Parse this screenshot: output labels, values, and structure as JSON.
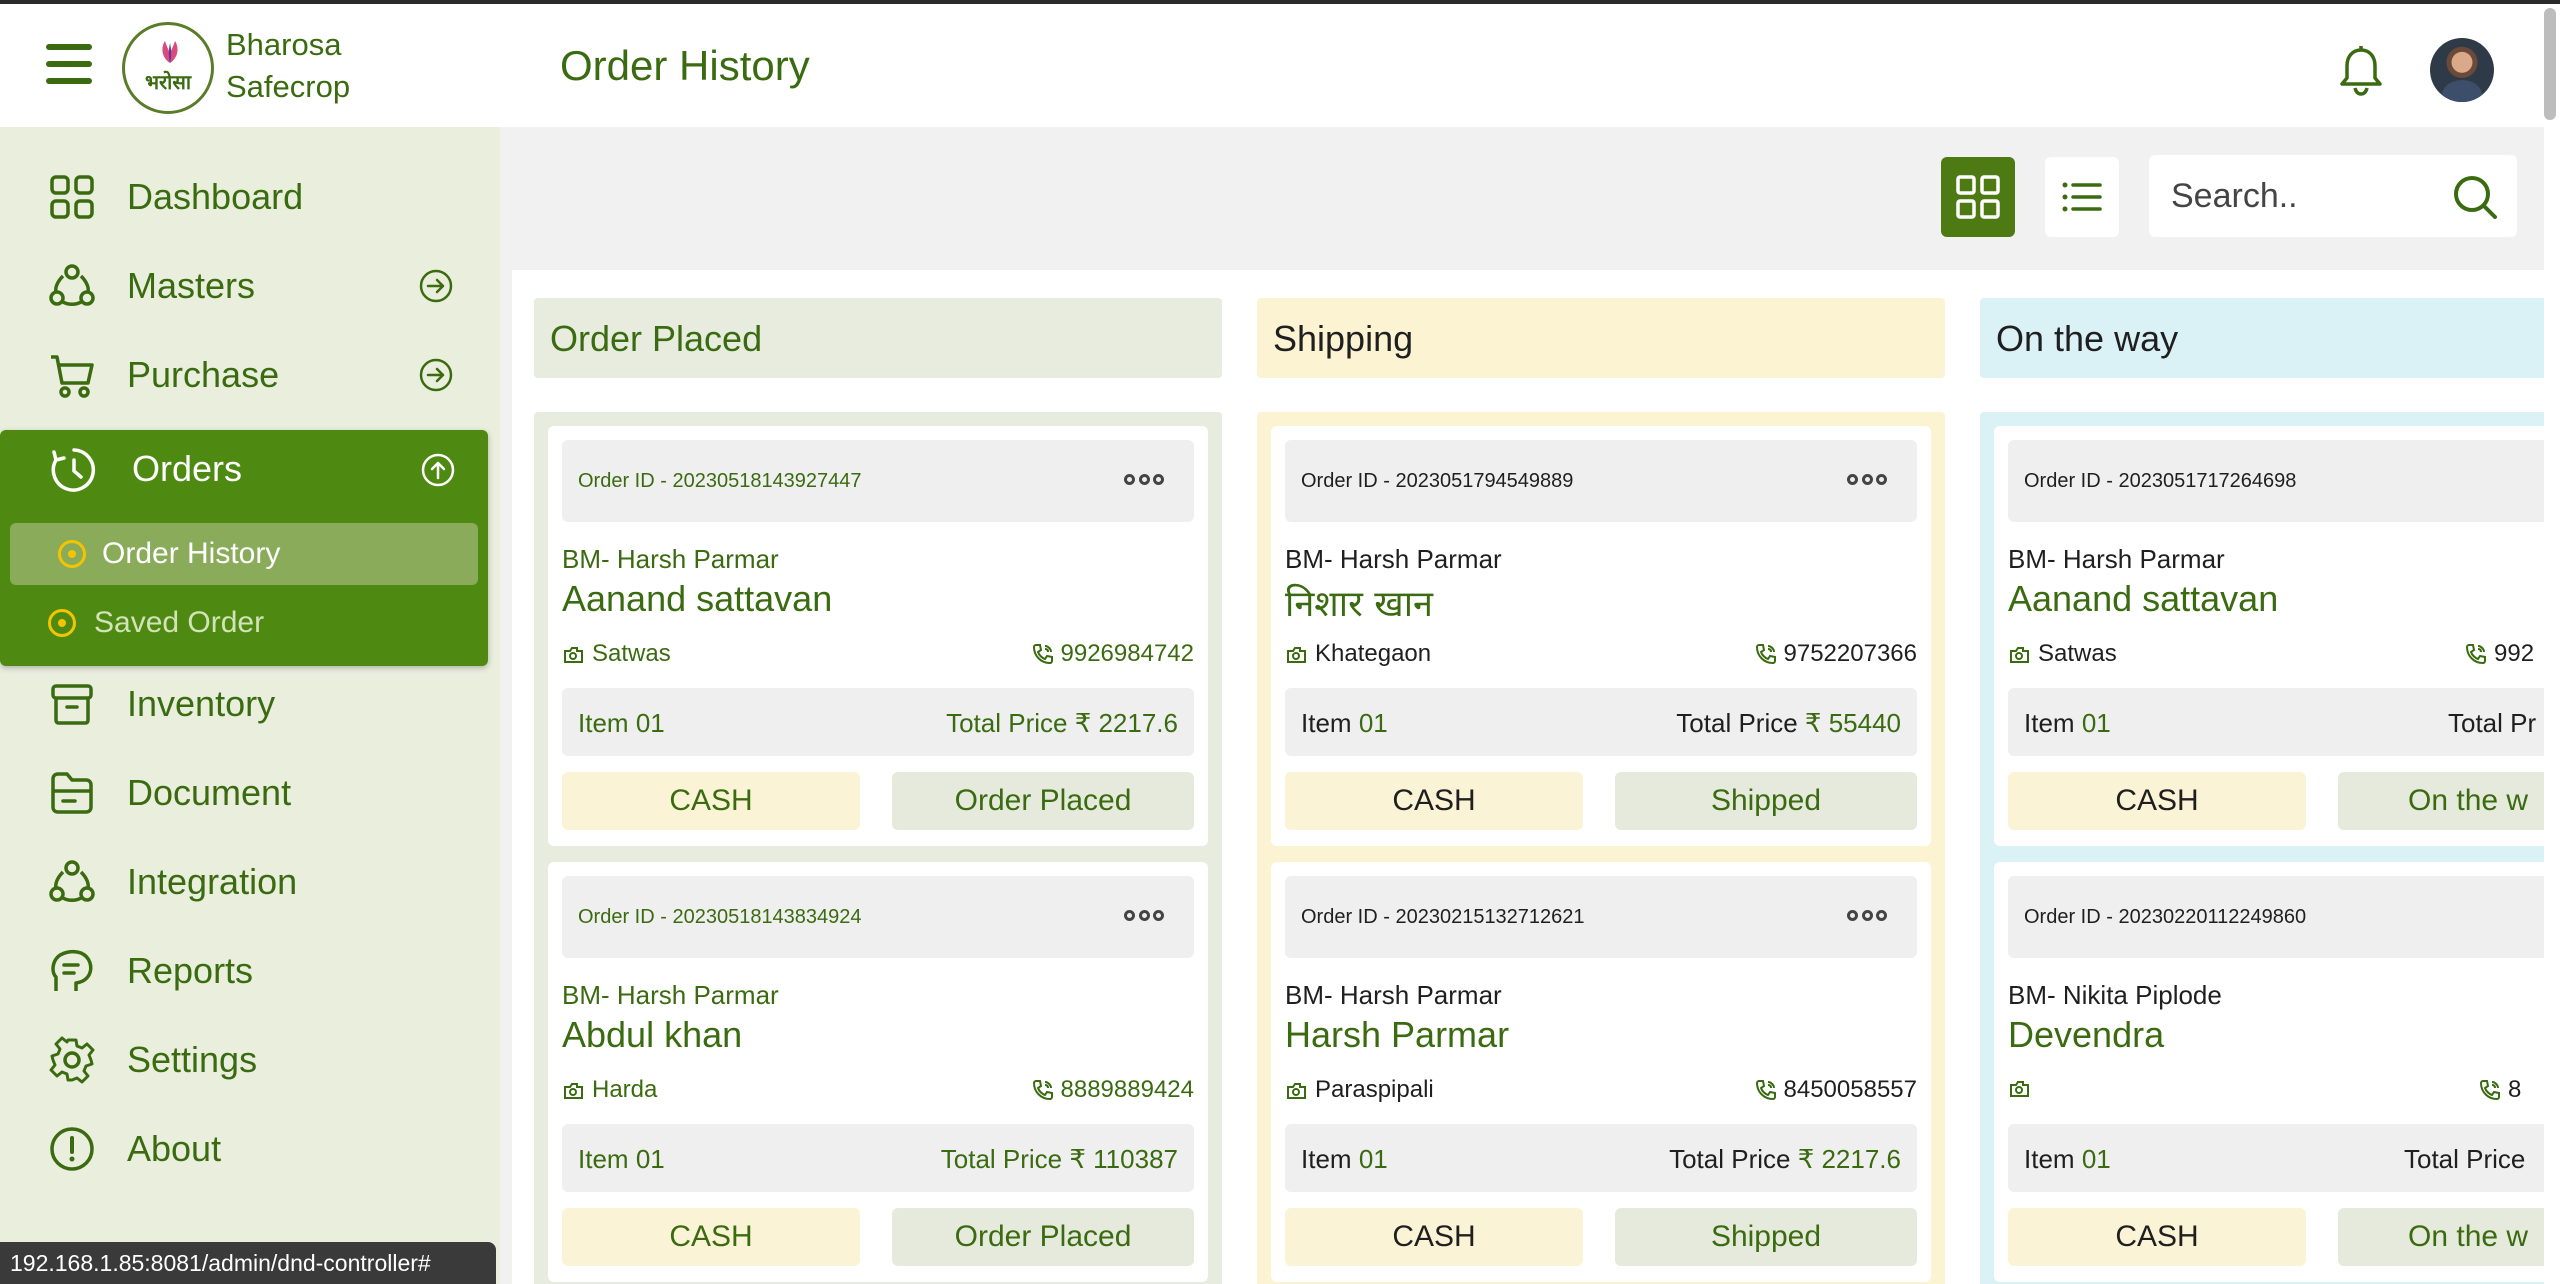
{
  "app": {
    "brand_line1": "Bharosa",
    "brand_line2": "Safecrop",
    "logo_text": "भरोसा",
    "page_title": "Order History"
  },
  "colors": {
    "primary": "#3b6b10",
    "sidebar_bg": "#e9eedd",
    "orders_active_bg": "#4e8a12",
    "col_placed": "#e8ecdf",
    "col_shipping": "#fbf3d2",
    "col_ontheway": "#daf2f6"
  },
  "sidebar": {
    "items": [
      {
        "label": "Dashboard",
        "icon": "grid-icon"
      },
      {
        "label": "Masters",
        "icon": "hub-icon"
      },
      {
        "label": "Purchase",
        "icon": "cart-icon"
      },
      {
        "label": "Orders",
        "icon": "clock-icon"
      },
      {
        "label": "Inventory",
        "icon": "box-icon"
      },
      {
        "label": "Document",
        "icon": "folder-icon"
      },
      {
        "label": "Integration",
        "icon": "hub-icon"
      },
      {
        "label": "Reports",
        "icon": "report-icon"
      },
      {
        "label": "Settings",
        "icon": "gear-icon"
      },
      {
        "label": "About",
        "icon": "info-icon"
      }
    ],
    "orders_sub": [
      {
        "label": "Order History"
      },
      {
        "label": "Saved Order"
      }
    ]
  },
  "toolbar": {
    "search_placeholder": "Search.."
  },
  "columns": [
    {
      "title": "Order Placed",
      "cards": [
        {
          "order_id": "Order ID - 20230518143927447",
          "bm": "BM- Harsh Parmar",
          "customer": "Aanand sattavan",
          "location": "Satwas",
          "phone": "9926984742",
          "item_label": "Item",
          "item_count": "01",
          "total_label": "Total Price",
          "total": "₹ 2217.6",
          "payment": "CASH",
          "status": "Order Placed"
        },
        {
          "order_id": "Order ID - 20230518143834924",
          "bm": "BM- Harsh Parmar",
          "customer": "Abdul khan",
          "location": "Harda",
          "phone": "8889889424",
          "item_label": "Item",
          "item_count": "01",
          "total_label": "Total Price",
          "total": "₹ 110387",
          "payment": "CASH",
          "status": "Order Placed"
        }
      ]
    },
    {
      "title": "Shipping",
      "cards": [
        {
          "order_id": "Order ID - 2023051794549889",
          "bm": "BM- Harsh Parmar",
          "customer": "निशार खान",
          "location": "Khategaon",
          "phone": "9752207366",
          "item_label": "Item",
          "item_count": "01",
          "total_label": "Total Price",
          "total": "₹ 55440",
          "payment": "CASH",
          "status": "Shipped"
        },
        {
          "order_id": "Order ID - 20230215132712621",
          "bm": "BM- Harsh Parmar",
          "customer": "Harsh Parmar",
          "location": "Paraspipali",
          "phone": "8450058557",
          "item_label": "Item",
          "item_count": "01",
          "total_label": "Total Price",
          "total": "₹ 2217.6",
          "payment": "CASH",
          "status": "Shipped"
        }
      ]
    },
    {
      "title": "On the way",
      "cards": [
        {
          "order_id": "Order ID - 2023051717264698",
          "bm": "BM- Harsh Parmar",
          "customer": "Aanand sattavan",
          "location": "Satwas",
          "phone": "992",
          "item_label": "Item",
          "item_count": "01",
          "total_label": "Total Pr",
          "total": "",
          "payment": "CASH",
          "status": "On the w"
        },
        {
          "order_id": "Order ID - 20230220112249860",
          "bm": "BM- Nikita Piplode",
          "customer": "Devendra",
          "location": "",
          "phone": "8",
          "item_label": "Item",
          "item_count": "01",
          "total_label": "Total Price",
          "total": "",
          "payment": "CASH",
          "status": "On the w"
        }
      ]
    }
  ],
  "status_bar": {
    "url": "192.168.1.85:8081/admin/dnd-controller#"
  }
}
